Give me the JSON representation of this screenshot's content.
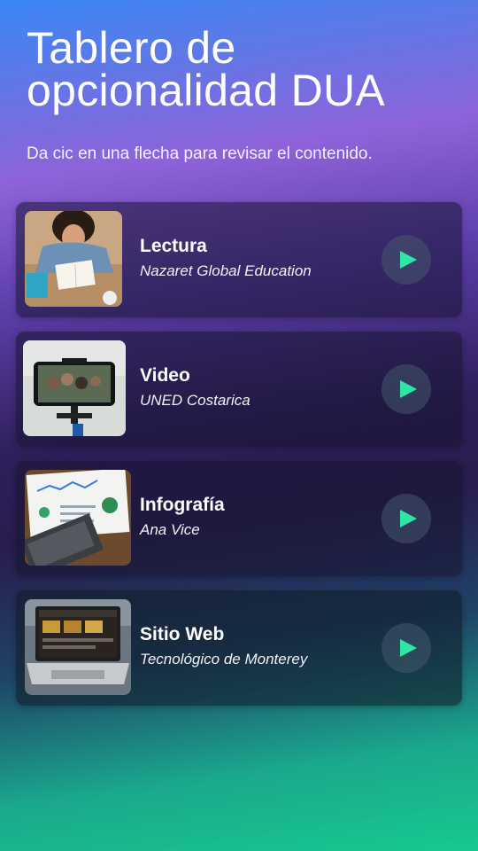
{
  "header": {
    "title": "Tablero de opcionalidad DUA",
    "subtitle": "Da cic en una flecha para revisar el contenido."
  },
  "cards": [
    {
      "title": "Lectura",
      "source": "Nazaret Global Education",
      "image": "reading-photo",
      "action_icon": "play-icon"
    },
    {
      "title": "Video",
      "source": "UNED Costarica",
      "image": "phone-video-photo",
      "action_icon": "play-icon"
    },
    {
      "title": "Infografía",
      "source": "Ana Vice",
      "image": "infographic-photo",
      "action_icon": "play-icon"
    },
    {
      "title": "Sitio Web",
      "source": "Tecnológico de Monterey",
      "image": "laptop-website-photo",
      "action_icon": "play-icon"
    }
  ],
  "colors": {
    "accent": "#2ee6a6",
    "gradient_top": "#3a86f6",
    "gradient_mid": "#2e1f5a",
    "gradient_bottom": "#17c98e"
  }
}
